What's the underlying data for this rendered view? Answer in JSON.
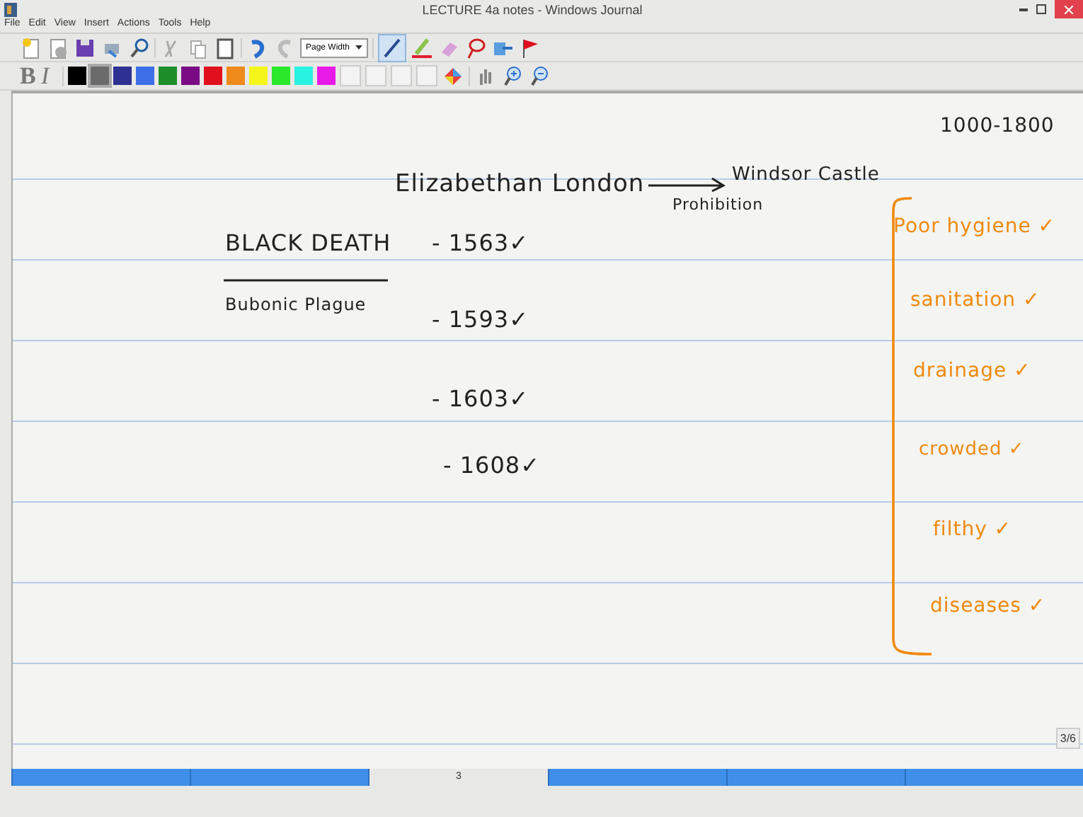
{
  "window": {
    "title": "LECTURE 4a notes - Windows Journal"
  },
  "menu": [
    "File",
    "Edit",
    "View",
    "Insert",
    "Actions",
    "Tools",
    "Help"
  ],
  "zoom": {
    "value": "Page Width"
  },
  "format": {
    "bold": "B",
    "italic": "I"
  },
  "palette": [
    {
      "color": "#000000",
      "selected": false
    },
    {
      "color": "#6b6b6b",
      "selected": true
    },
    {
      "color": "#2e3192",
      "selected": false
    },
    {
      "color": "#3f6fe8",
      "selected": false
    },
    {
      "color": "#1e8e2a",
      "selected": false
    },
    {
      "color": "#7a0b84",
      "selected": false
    },
    {
      "color": "#e0101c",
      "selected": false
    },
    {
      "color": "#ee8a1c",
      "selected": false
    },
    {
      "color": "#f5f51a",
      "selected": false
    },
    {
      "color": "#2ae82a",
      "selected": false
    },
    {
      "color": "#2af2e0",
      "selected": false
    },
    {
      "color": "#e81ae8",
      "selected": false
    }
  ],
  "ink": [
    {
      "text": "1000-1800",
      "color": "#222222"
    },
    {
      "text": "Elizabethan London",
      "color": "#222222"
    },
    {
      "text": "Windsor Castle",
      "color": "#222222"
    },
    {
      "text": "Prohibition",
      "color": "#222222"
    },
    {
      "text": "BLACK DEATH",
      "color": "#222222"
    },
    {
      "text": "Bubonic Plague",
      "color": "#222222"
    },
    {
      "text": "- 1563✓",
      "color": "#222222"
    },
    {
      "text": "- 1593✓",
      "color": "#222222"
    },
    {
      "text": "- 1603✓",
      "color": "#222222"
    },
    {
      "text": "- 1608✓",
      "color": "#222222"
    },
    {
      "text": "Poor hygiene ✓",
      "color": "#ee8a10"
    },
    {
      "text": "sanitation ✓",
      "color": "#ee8a10"
    },
    {
      "text": "drainage ✓",
      "color": "#ee8a10"
    },
    {
      "text": "crowded ✓",
      "color": "#ee8a10"
    },
    {
      "text": "filthy ✓",
      "color": "#ee8a10"
    },
    {
      "text": "diseases ✓",
      "color": "#ee8a10"
    }
  ],
  "page_indicator": "3/6",
  "page_tabs": [
    {
      "selected": false
    },
    {
      "selected": false
    },
    {
      "label": "3",
      "selected": true
    },
    {
      "selected": false
    },
    {
      "selected": false
    },
    {
      "selected": false
    }
  ]
}
